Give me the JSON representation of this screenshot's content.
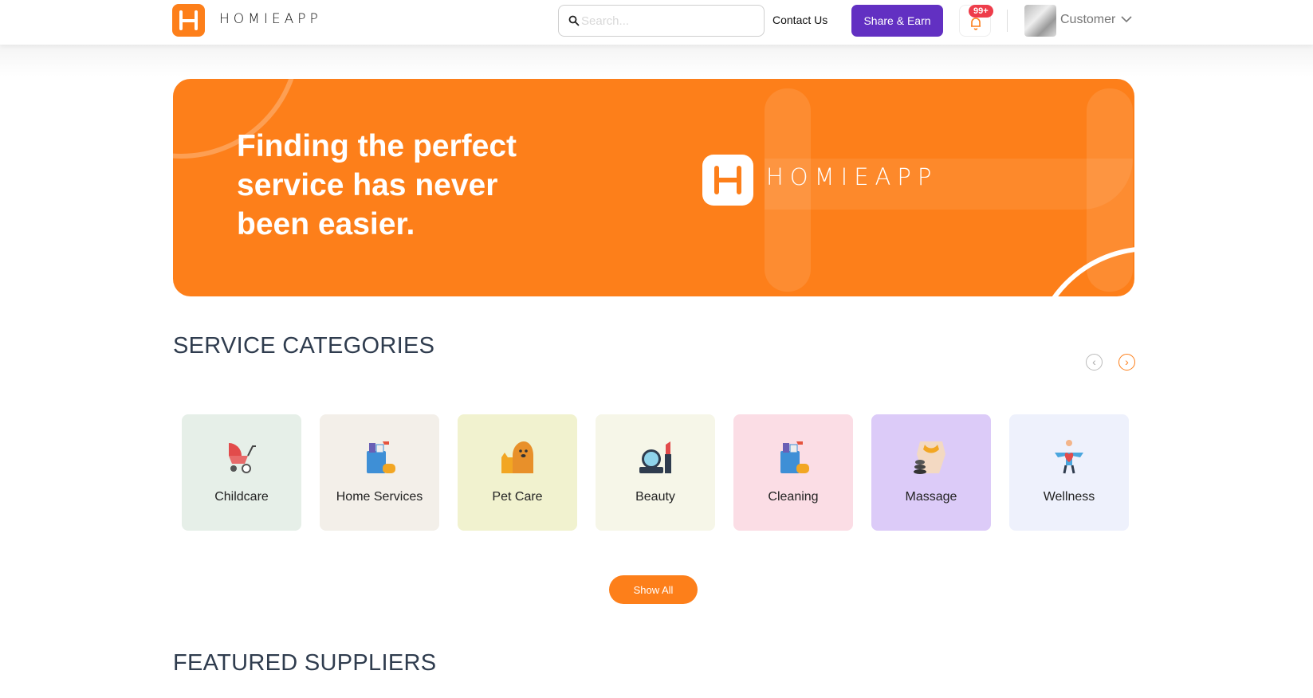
{
  "header": {
    "logo_text": "HOMIEAPP",
    "search_placeholder": "Search...",
    "contact_label": "Contact Us",
    "share_label": "Share & Earn",
    "notification_badge": "99+",
    "user_name": "Customer",
    "brand_color": "#fd7f1a",
    "share_color": "#6230c2"
  },
  "banner": {
    "headline": "Finding the perfect service has never been easier.",
    "logo_text": "HOMIEAPP"
  },
  "categories": {
    "title": "SERVICE CATEGORIES",
    "items": [
      {
        "label": "Childcare",
        "icon": "stroller-icon",
        "bg": "#e6efe8"
      },
      {
        "label": "Home Services",
        "icon": "cleaning-supplies-icon",
        "bg": "#f3efe9"
      },
      {
        "label": "Pet Care",
        "icon": "pets-icon",
        "bg": "#f1f2cf"
      },
      {
        "label": "Beauty",
        "icon": "makeup-icon",
        "bg": "#f6f6e8"
      },
      {
        "label": "Cleaning",
        "icon": "cleaning-supplies-icon",
        "bg": "#fbdde5"
      },
      {
        "label": "Massage",
        "icon": "massage-icon",
        "bg": "#dccbf8"
      },
      {
        "label": "Wellness",
        "icon": "wellness-icon",
        "bg": "#eef1fc"
      }
    ],
    "show_all_label": "Show All"
  },
  "featured": {
    "title": "FEATURED SUPPLIERS"
  }
}
